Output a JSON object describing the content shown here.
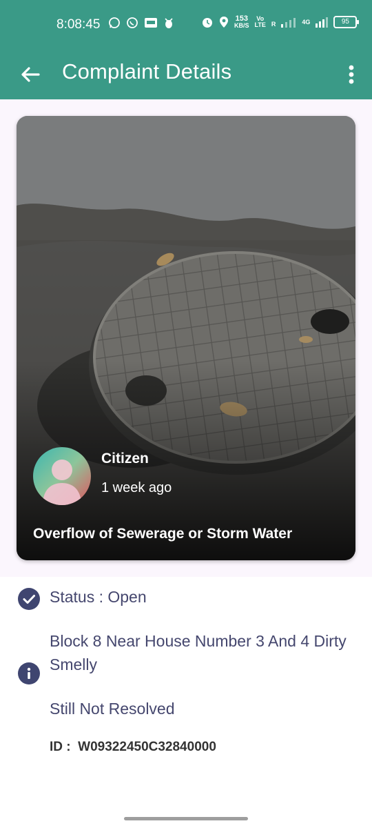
{
  "status_bar": {
    "time": "8:08:45",
    "net_speed_value": "153",
    "net_speed_unit": "KB/S",
    "volte_top": "Vo",
    "volte_bottom": "LTE",
    "roaming_label": "R",
    "network_type": "4G",
    "battery": "95"
  },
  "app_bar": {
    "title": "Complaint Details"
  },
  "card": {
    "author": "Citizen",
    "posted": "1 week ago",
    "title": "Overflow of Sewerage or Storm Water"
  },
  "details": {
    "status": "Status : Open",
    "description": "Block 8 Near House Number 3 And 4 Dirty Smelly",
    "note": "Still Not Resolved",
    "id_label": "ID :",
    "id_value": "W09322450C32840000"
  },
  "colors": {
    "app_bar": "#3a9a87",
    "card_background": "#fbf6fd",
    "icon_circle": "#3f4570",
    "body_text": "#45476e"
  }
}
